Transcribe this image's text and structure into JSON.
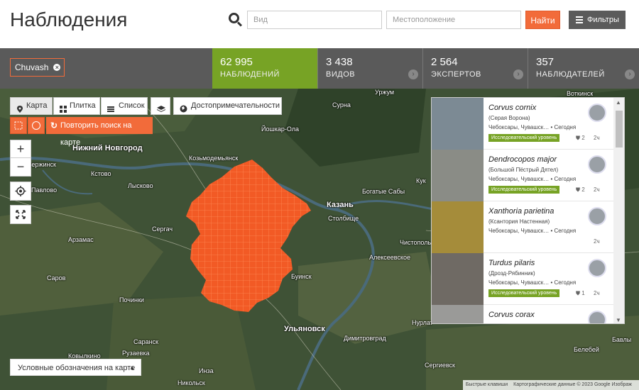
{
  "header": {
    "title": "Наблюдения",
    "species_placeholder": "Вид",
    "location_placeholder": "Местоположение",
    "find_label": "Найти",
    "filters_label": "Фильтры"
  },
  "stats": {
    "place_chip": "Chuvash",
    "observations": {
      "value": "62 995",
      "label": "НАБЛЮДЕНИЙ"
    },
    "species": {
      "value": "3 438",
      "label": "ВИДОВ"
    },
    "experts": {
      "value": "2 564",
      "label": "ЭКСПЕРТОВ"
    },
    "observers": {
      "value": "357",
      "label": "НАБЛЮДАТЕЛЕЙ"
    }
  },
  "map_controls": {
    "tab_map": "Карта",
    "tab_grid": "Плитка",
    "tab_list": "Список",
    "landmarks": "Достопримечательности",
    "redo_search": "Повторить поиск на карте",
    "zoom_in": "+",
    "zoom_out": "−",
    "legend": "Условные обозначения на карте",
    "shortcuts": "Быстрые клавиши",
    "map_data": "Картографические данные © 2023 Google Изображ"
  },
  "cities": [
    {
      "name": "Нижний Новгород",
      "cls": "mid"
    },
    {
      "name": "Казань",
      "cls": "mid"
    },
    {
      "name": "Ульяновск",
      "cls": "mid"
    },
    {
      "name": "Йошкар-Ола",
      "cls": ""
    },
    {
      "name": "Козьмодемьянск",
      "cls": ""
    },
    {
      "name": "Дзержинск",
      "cls": ""
    },
    {
      "name": "Кстово",
      "cls": ""
    },
    {
      "name": "Павлово",
      "cls": ""
    },
    {
      "name": "Лысково",
      "cls": ""
    },
    {
      "name": "Сергач",
      "cls": ""
    },
    {
      "name": "Арзамас",
      "cls": ""
    },
    {
      "name": "Саров",
      "cls": ""
    },
    {
      "name": "Починки",
      "cls": ""
    },
    {
      "name": "Саранск",
      "cls": ""
    },
    {
      "name": "Рузаевка",
      "cls": ""
    },
    {
      "name": "Ковылкино",
      "cls": ""
    },
    {
      "name": "Инза",
      "cls": ""
    },
    {
      "name": "Никольск",
      "cls": ""
    },
    {
      "name": "Сурна",
      "cls": ""
    },
    {
      "name": "Уржум",
      "cls": ""
    },
    {
      "name": "Воткинск",
      "cls": ""
    },
    {
      "name": "Столбище",
      "cls": ""
    },
    {
      "name": "Богатые Сабы",
      "cls": ""
    },
    {
      "name": "Алексеевское",
      "cls": ""
    },
    {
      "name": "Чистополь",
      "cls": ""
    },
    {
      "name": "Буинск",
      "cls": ""
    },
    {
      "name": "Димитровград",
      "cls": ""
    },
    {
      "name": "Нурлат",
      "cls": ""
    },
    {
      "name": "Сергиевск",
      "cls": ""
    },
    {
      "name": "Белебей",
      "cls": ""
    },
    {
      "name": "Кук",
      "cls": ""
    },
    {
      "name": "Бавлы",
      "cls": ""
    }
  ],
  "observations": [
    {
      "name": "Corvus cornix",
      "common": "(Серая Ворона)",
      "place": "Чебоксары, Чувашск… • Сегодня",
      "badge": "Исследовательский уровень",
      "ids": "2",
      "time": "2ч"
    },
    {
      "name": "Dendrocopos major",
      "common": "(Большой Пёстрый Дятел)",
      "place": "Чебоксары, Чувашск… • Сегодня",
      "badge": "Исследовательский уровень",
      "ids": "2",
      "time": "2ч"
    },
    {
      "name": "Xanthoria parietina",
      "common": "(Ксантория Настенная)",
      "place": "Чебоксары, Чувашск… • Сегодня",
      "badge": "",
      "ids": "",
      "time": "2ч"
    },
    {
      "name": "Turdus pilaris",
      "common": "(Дрозд-Рябинник)",
      "place": "Чебоксары, Чувашск… • Сегодня",
      "badge": "Исследовательский уровень",
      "ids": "1",
      "time": "2ч"
    },
    {
      "name": "Corvus corax",
      "common": "",
      "place": "",
      "badge": "",
      "ids": "",
      "time": ""
    }
  ],
  "colors": {
    "accent": "#f26b3a",
    "green": "#77a325",
    "statsbar": "#5a5a5a"
  }
}
